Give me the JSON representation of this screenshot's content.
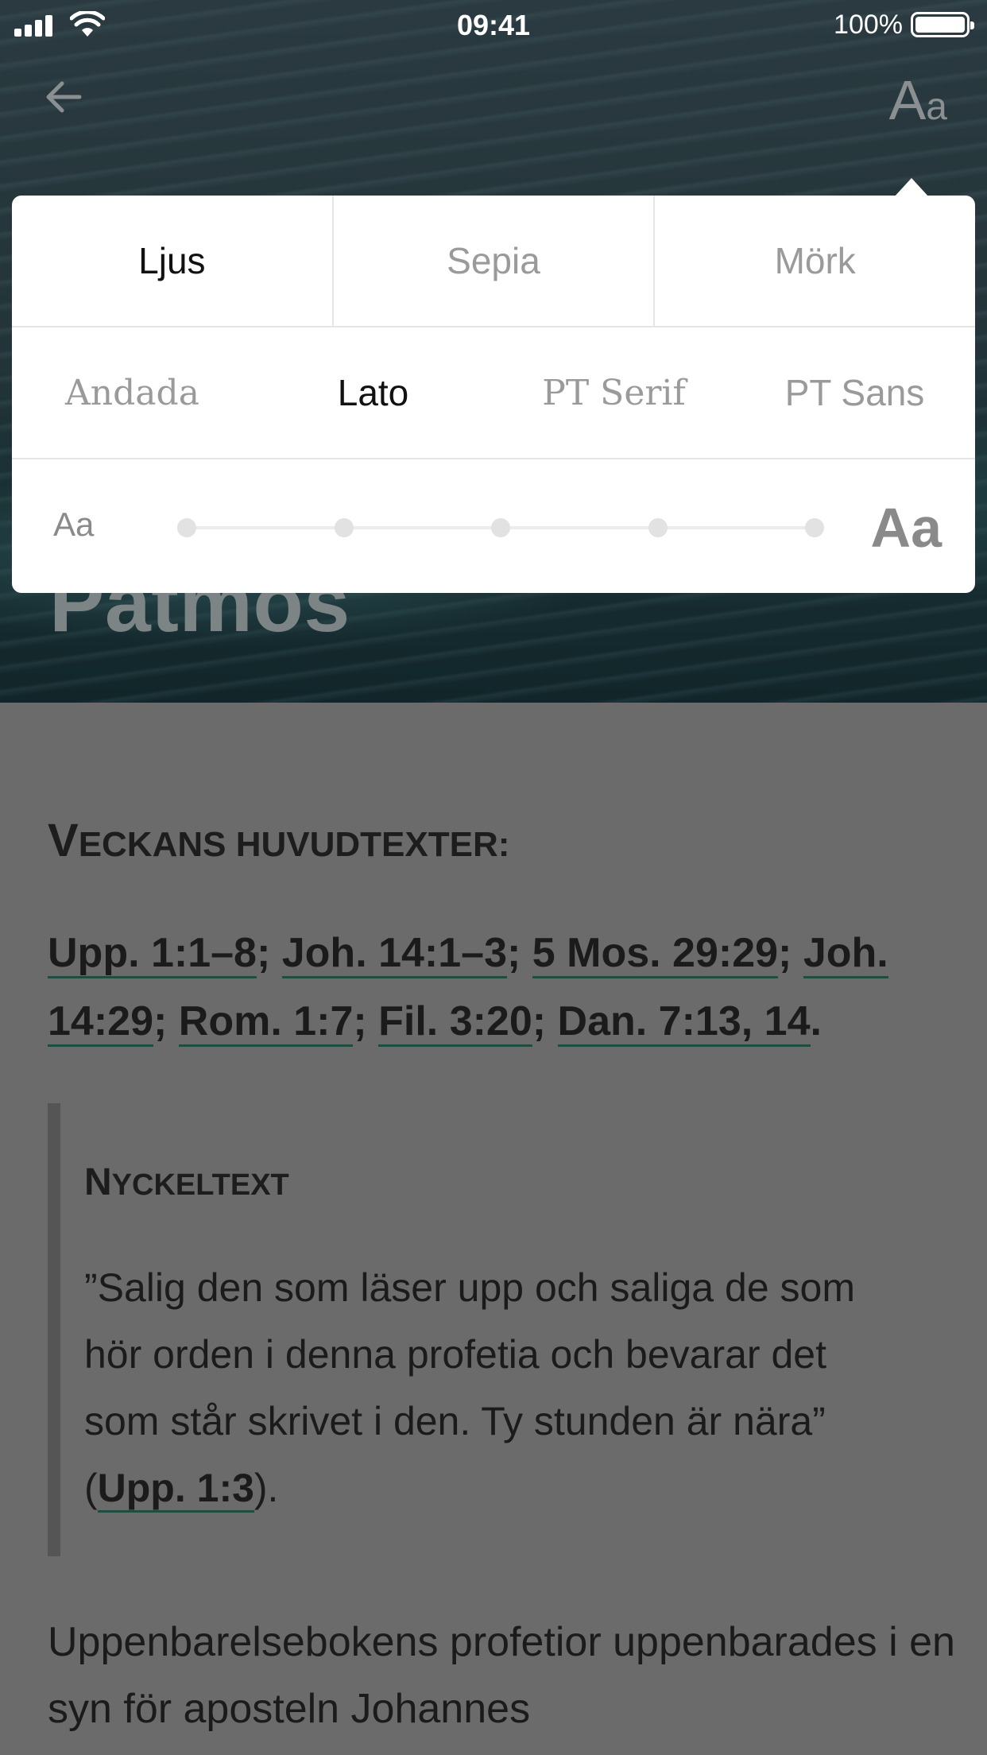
{
  "status_bar": {
    "time": "09:41",
    "battery": "100%"
  },
  "nav": {
    "back_icon": "arrow-left-icon",
    "font_button_big": "A",
    "font_button_small": "a"
  },
  "hero": {
    "title": "Patmos"
  },
  "settings": {
    "themes": [
      {
        "label": "Ljus",
        "selected": true
      },
      {
        "label": "Sepia",
        "selected": false
      },
      {
        "label": "Mörk",
        "selected": false
      }
    ],
    "fonts": [
      {
        "label": "Andada",
        "selected": false
      },
      {
        "label": "Lato",
        "selected": true
      },
      {
        "label": "PT Serif",
        "selected": false
      },
      {
        "label": "PT Sans",
        "selected": false
      }
    ],
    "size_small_label": "Aa",
    "size_large_label": "Aa",
    "size_levels": 5
  },
  "content": {
    "heading_initial": "V",
    "heading_rest": "ECKANS HUVUDTEXTER:",
    "key_verses": [
      "Upp. 1:1–8",
      "Joh. 14:1–3",
      "5 Mos. 29:29",
      "Joh. 14:29",
      "Rom. 1:7",
      "Fil. 3:20",
      "Dan. 7:13, 14"
    ],
    "key_text_initial": "N",
    "key_text_rest": "YCKELTEXT",
    "key_text_quote": "”Salig den som läser upp och saliga de som hör orden i denna profetia och bevarar det som står skrivet i den. Ty stunden är nära” (",
    "key_text_ref": "Upp. 1:3",
    "key_text_end": ").",
    "body": "Uppenbarelsebokens profetior uppenbarades i en syn för aposteln Johannes"
  },
  "colors": {
    "link_underline": "#1f4d42",
    "overlay": "#6b6b6b"
  }
}
